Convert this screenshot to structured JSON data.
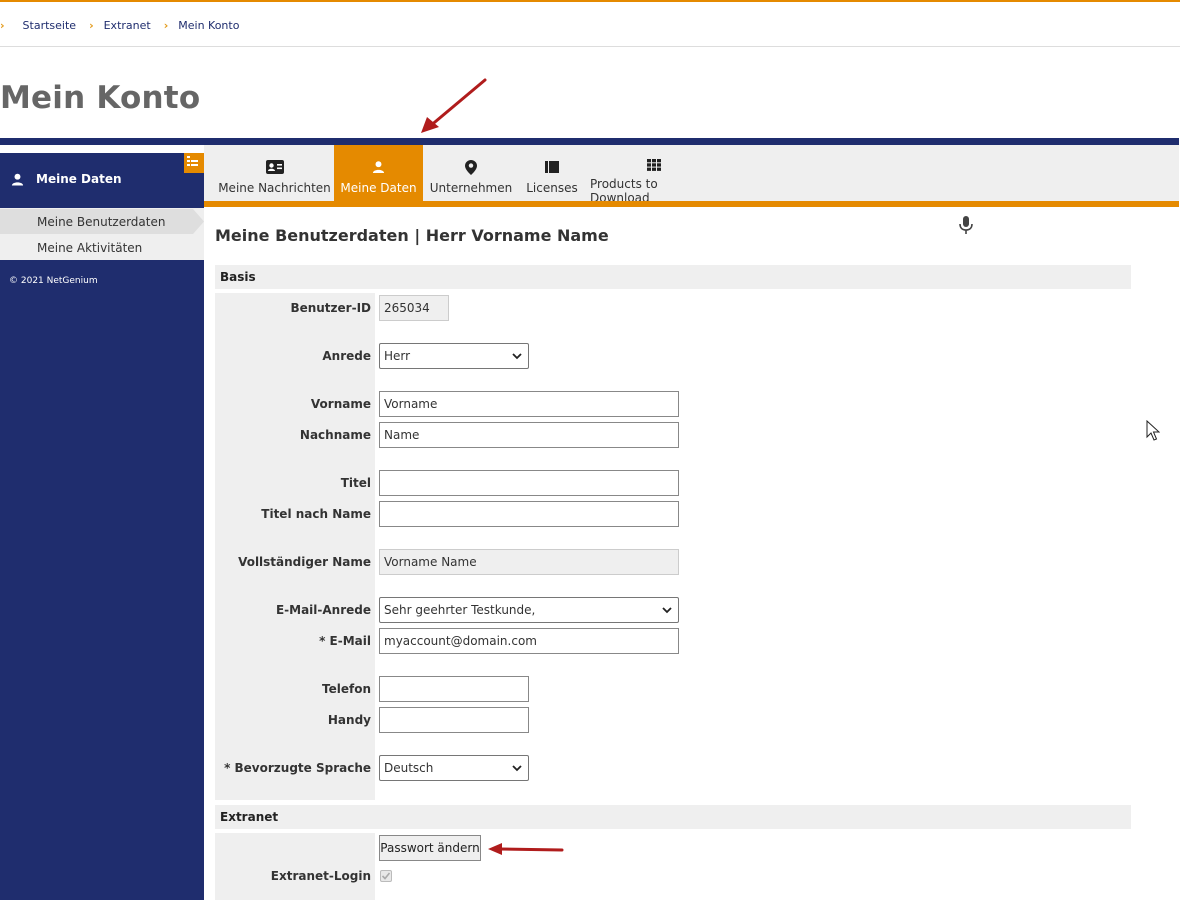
{
  "breadcrumb": {
    "items": [
      "Startseite",
      "Extranet",
      "Mein Konto"
    ]
  },
  "page": {
    "title": "Mein Konto"
  },
  "tabs": [
    {
      "label": "Meine Nachrichten",
      "icon": "id-card-icon",
      "active": false
    },
    {
      "label": "Meine Daten",
      "icon": "user-icon",
      "active": true
    },
    {
      "label": "Unternehmen",
      "icon": "map-pin-icon",
      "active": false
    },
    {
      "label": "Licenses",
      "icon": "list-icon",
      "active": false
    },
    {
      "label": "Products to Download",
      "icon": "grid-icon",
      "active": false
    }
  ],
  "sidebar": {
    "header": "Meine Daten",
    "items": [
      {
        "label": "Meine Benutzerdaten",
        "active": true
      },
      {
        "label": "Meine Aktivitäten",
        "active": false
      }
    ],
    "copyright": "© 2021 NetGenium"
  },
  "content": {
    "title": "Meine Benutzerdaten | Herr Vorname Name",
    "sections": {
      "basis": "Basis",
      "extranet": "Extranet"
    }
  },
  "form": {
    "benutzer_id": {
      "label": "Benutzer-ID",
      "value": "265034"
    },
    "anrede": {
      "label": "Anrede",
      "value": "Herr"
    },
    "vorname": {
      "label": "Vorname",
      "value": "Vorname"
    },
    "nachname": {
      "label": "Nachname",
      "value": "Name"
    },
    "titel": {
      "label": "Titel",
      "value": ""
    },
    "titel_nach": {
      "label": "Titel nach Name",
      "value": ""
    },
    "vollst_name": {
      "label": "Vollständiger Name",
      "value": "Vorname Name"
    },
    "email_anrede": {
      "label": "E-Mail-Anrede",
      "value": "Sehr geehrter Testkunde,"
    },
    "email": {
      "label": "* E-Mail",
      "value": "myaccount@domain.com"
    },
    "telefon": {
      "label": "Telefon",
      "value": ""
    },
    "handy": {
      "label": "Handy",
      "value": ""
    },
    "sprache": {
      "label": "* Bevorzugte Sprache",
      "value": "Deutsch"
    },
    "passwort_button": "Passwort ändern",
    "extranet_login": {
      "label": "Extranet-Login",
      "checked": true
    }
  },
  "colors": {
    "accent": "#e58a00",
    "navy": "#1f2d6e",
    "annotation_arrow": "#b01c1c"
  }
}
